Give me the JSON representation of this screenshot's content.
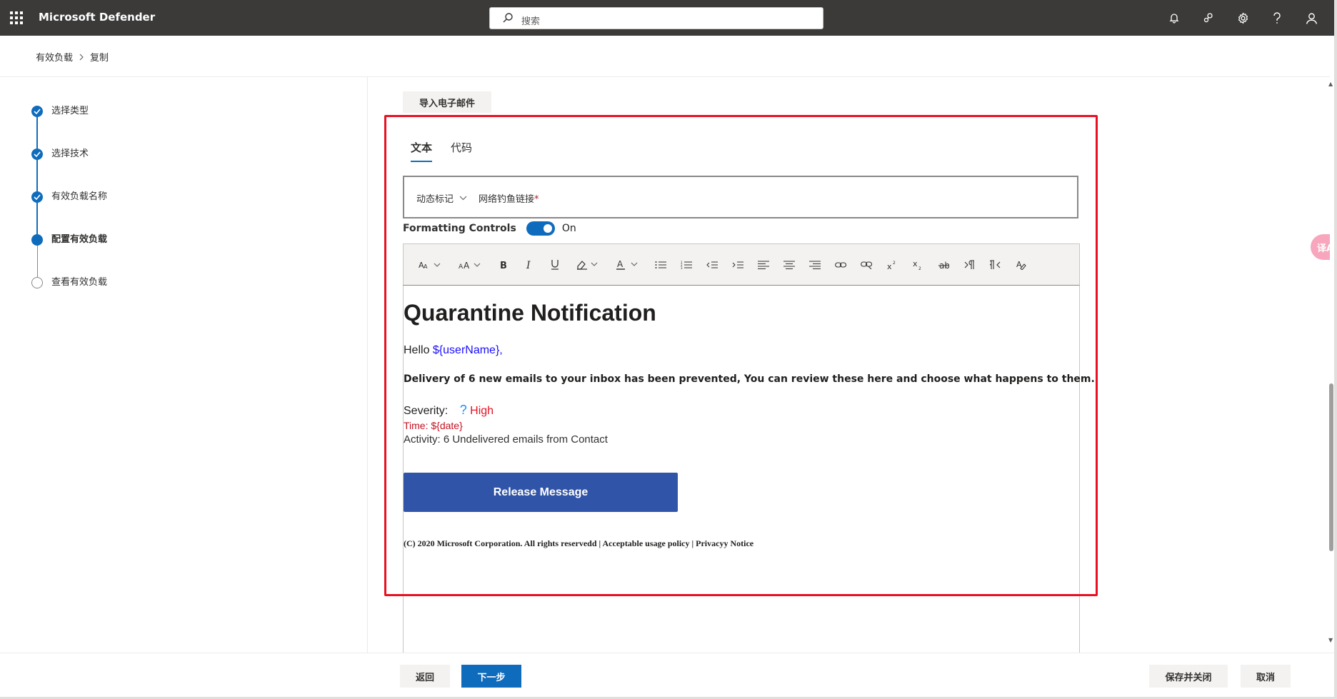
{
  "app": {
    "title": "Microsoft Defender"
  },
  "search": {
    "placeholder": "搜索"
  },
  "breadcrumb": {
    "items": [
      "有效负载",
      "复制"
    ]
  },
  "steps": [
    {
      "label": "选择类型",
      "state": "done"
    },
    {
      "label": "选择技术",
      "state": "done"
    },
    {
      "label": "有效负载名称",
      "state": "done"
    },
    {
      "label": "配置有效负载",
      "state": "current"
    },
    {
      "label": "查看有效负载",
      "state": "pending"
    }
  ],
  "editor": {
    "import_label": "导入电子邮件",
    "tabs": [
      "文本",
      "代码"
    ],
    "active_tab": "文本",
    "dynamic_tag_label": "动态标记",
    "phishing_link_label": "网络钓鱼链接",
    "required_mark": "*",
    "formatting_label": "Formatting Controls",
    "formatting_state": "On"
  },
  "email": {
    "title": "Quarantine Notification",
    "hello_prefix": "Hello ",
    "hello_var": "${userName},",
    "delivery": "Delivery of 6 new emails to your inbox has been prevented, You can review these here and choose what happens to them.",
    "severity_label": "Severity:",
    "severity_icon": "?",
    "severity_value": "High",
    "time_label": "Time: ",
    "time_var": "${date}",
    "activity": "Activity: 6 Undelivered emails from Contact",
    "release_button": "Release Message",
    "copyright": "(C) 2020 Microsoft Corporation. All rights reservedd | Acceptable usage policy | Privacyy Notice"
  },
  "side_button": {
    "label": "译A"
  },
  "footer": {
    "back": "返回",
    "next": "下一步",
    "save_close": "保存并关闭",
    "cancel": "取消"
  },
  "colors": {
    "accent": "#0f6cbd",
    "topbar": "#3b3a39",
    "release": "#3054a8",
    "highlight": "#e81123"
  }
}
